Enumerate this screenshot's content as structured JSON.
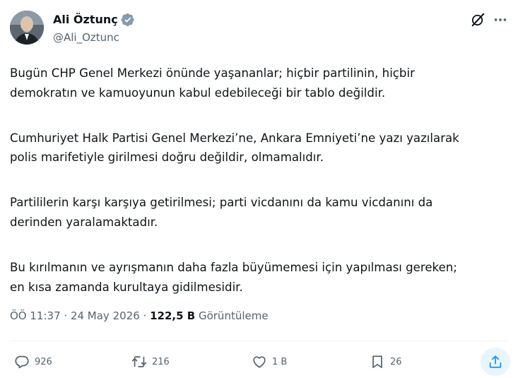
{
  "author": {
    "display_name": "Ali Öztunç",
    "handle": "@Ali_Oztunc",
    "verified_color": "#829aab"
  },
  "tweet": {
    "paragraphs": [
      [
        "Bugün CHP Genel Merkezi önünde yaşananlar; hiçbir partilinin, hiçbir",
        "demokratın ve kamuoyunun kabul edebileceği bir tablo değildir."
      ],
      [
        "Cumhuriyet Halk Partisi Genel Merkezi’ne, Ankara Emniyeti’ne yazı yazılarak",
        "polis marifetiyle girilmesi doğru değildir, olmamalıdır."
      ],
      [
        "Partililerin karşı karşıya getirilmesi; parti vicdanını da kamu vicdanını da",
        "derinden yaralamaktadır."
      ],
      [
        "Bu kırılmanın ve ayrışmanın daha fazla büyümemesi için yapılması gereken;",
        "en kısa zamanda kurultaya gidilmesidir."
      ]
    ],
    "time": "ÖÖ 11:37",
    "date": "24 May 2026",
    "views_count": "122,5 B",
    "views_label": "Görüntüleme"
  },
  "actions": {
    "replies": "926",
    "reposts": "216",
    "likes": "1 B",
    "bookmarks": "26"
  },
  "icons": [
    "grok-icon",
    "more-icon",
    "reply-icon",
    "repost-icon",
    "like-icon",
    "bookmark-icon",
    "share-icon"
  ],
  "colors": {
    "text": "#0f1419",
    "secondary": "#536471",
    "accent": "#1d9bf0"
  }
}
